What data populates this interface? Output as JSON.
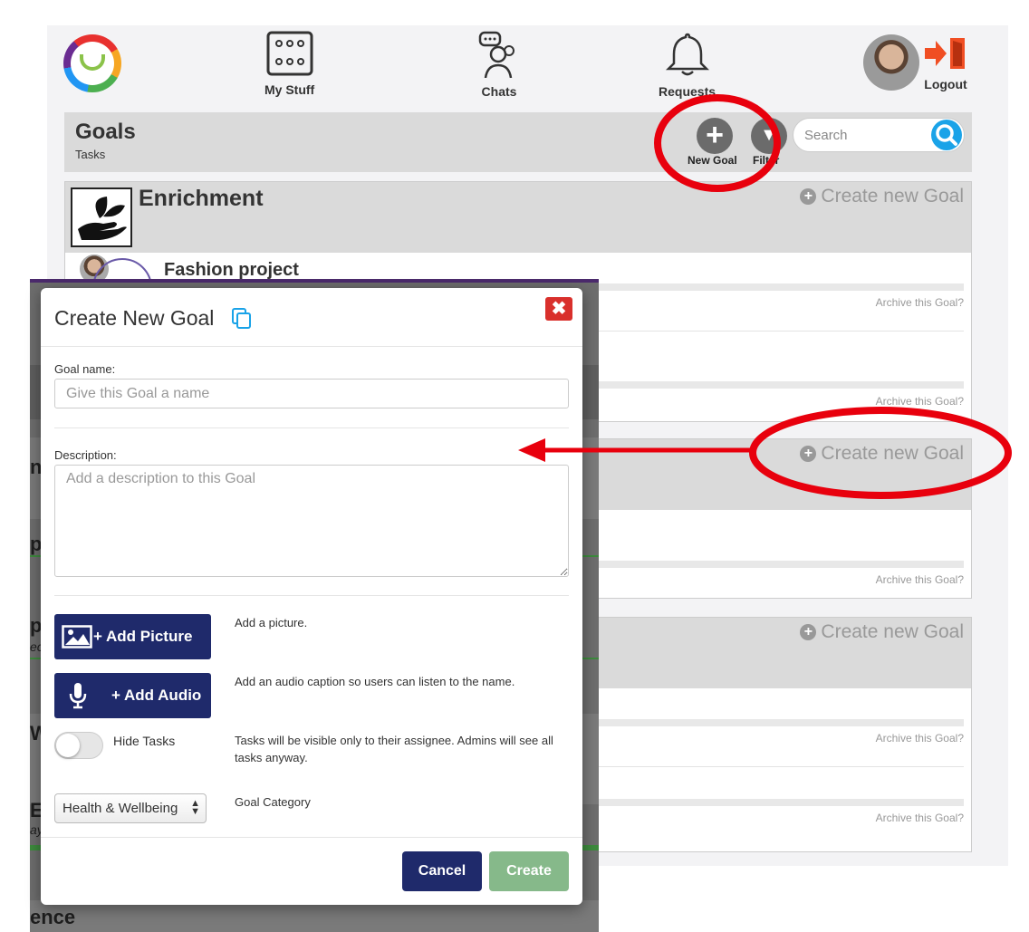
{
  "nav": {
    "my_stuff": "My Stuff",
    "chats": "Chats",
    "requests": "Requests",
    "logout": "Logout"
  },
  "goals_bar": {
    "title": "Goals",
    "subtitle": "Tasks",
    "new_goal": "New Goal",
    "filter": "Filter",
    "search_placeholder": "Search"
  },
  "categories": [
    {
      "name": "Enrichment",
      "create_label": "Create new Goal"
    },
    {
      "name": "",
      "create_label": "Create new Goal"
    },
    {
      "name": "",
      "create_label": "Create new Goal"
    }
  ],
  "goal_rows": {
    "first_goal": "Fashion project",
    "archive_label": "Archive this Goal?"
  },
  "background_fragments": [
    "n",
    "p",
    "pj",
    "ec",
    "W",
    "E",
    "ay",
    "ence"
  ],
  "modal": {
    "title": "Create New Goal",
    "goal_name_label": "Goal name:",
    "goal_name_placeholder": "Give this Goal a name",
    "description_label": "Description:",
    "description_placeholder": "Add a description to this Goal",
    "add_picture": "+ Add Picture",
    "add_picture_help": "Add a picture.",
    "add_audio": "+ Add Audio",
    "add_audio_help": "Add an audio caption so users can listen to the name.",
    "hide_tasks": "Hide Tasks",
    "hide_tasks_help": "Tasks will be visible only to their assignee. Admins will see all tasks anyway.",
    "category_value": "Health & Wellbeing",
    "category_label": "Goal Category",
    "cancel": "Cancel",
    "create": "Create"
  },
  "colors": {
    "primary_navy": "#1f2a6b",
    "create_green": "#86b98a",
    "close_red": "#d9302c",
    "annotation_red": "#e8000d",
    "search_blue": "#1aa3e8"
  }
}
